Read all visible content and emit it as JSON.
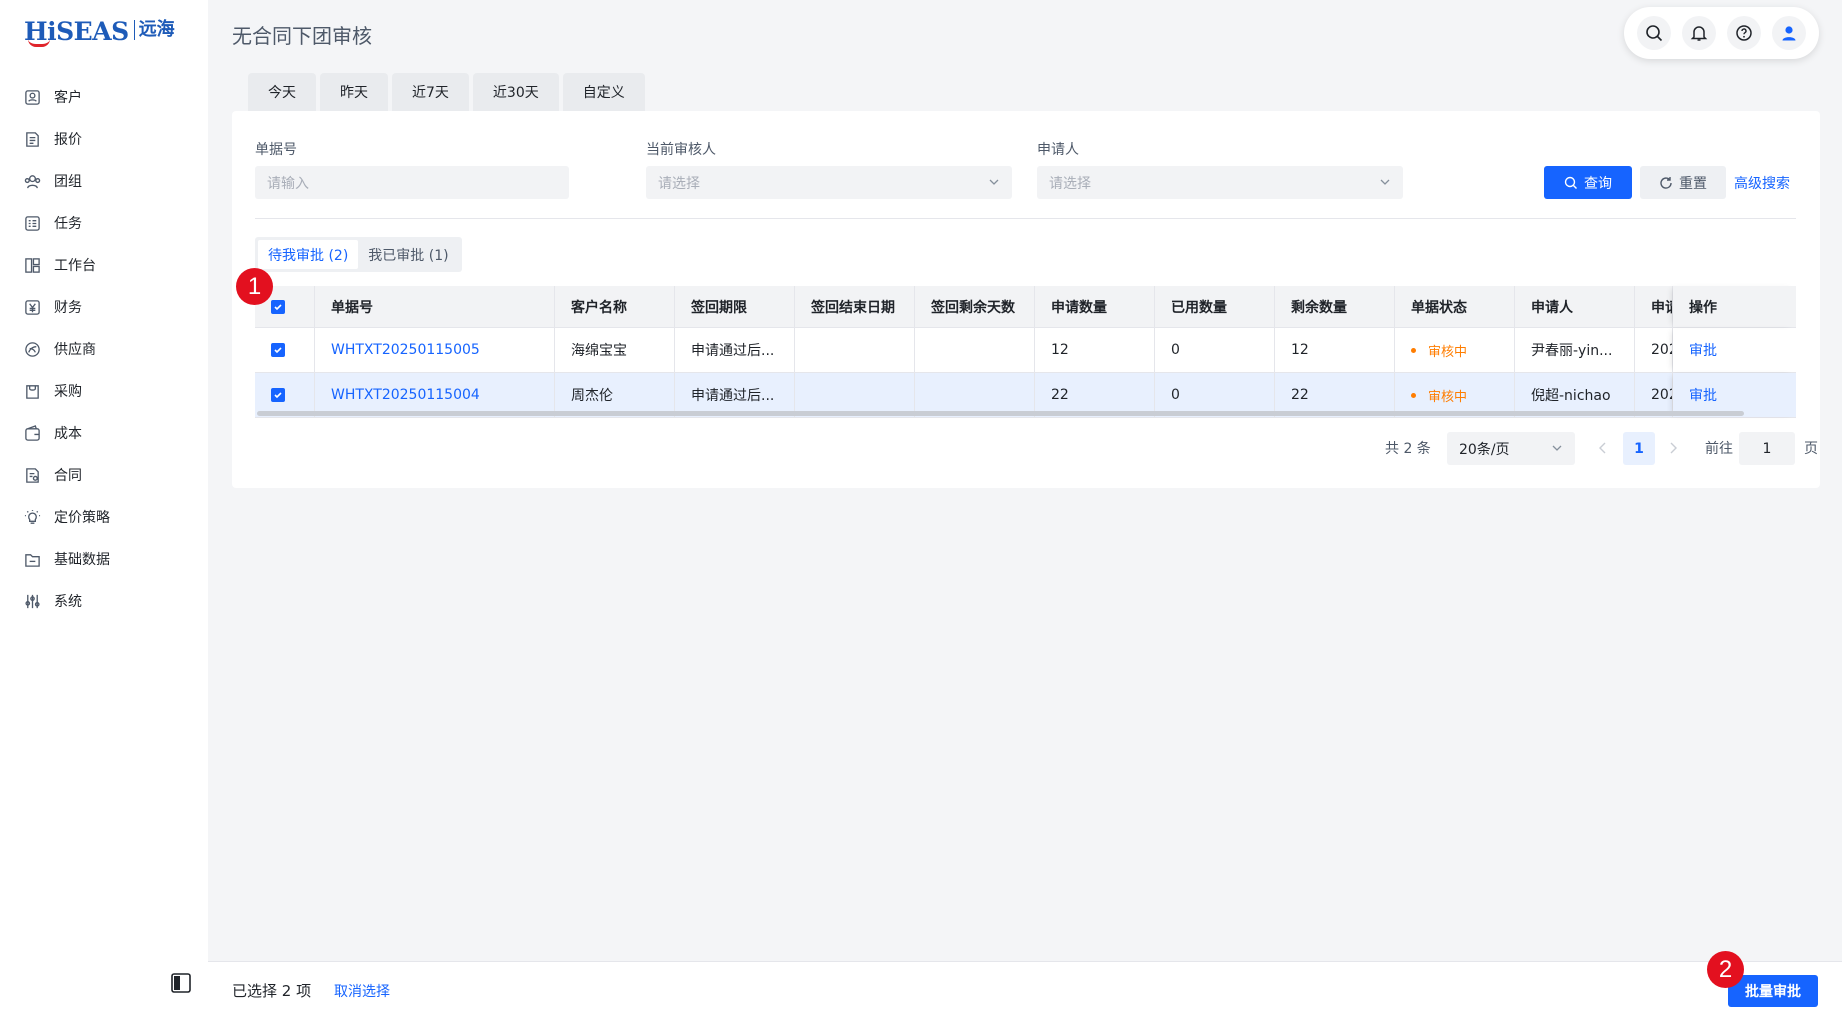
{
  "app": {
    "logo_en": "HiSEAS",
    "logo_cn": "远海",
    "page_title": "无合同下团审核"
  },
  "sidebar": {
    "items": [
      {
        "label": "客户",
        "icon": "customer-icon"
      },
      {
        "label": "报价",
        "icon": "quote-icon"
      },
      {
        "label": "团组",
        "icon": "group-icon"
      },
      {
        "label": "任务",
        "icon": "task-icon"
      },
      {
        "label": "工作台",
        "icon": "workbench-icon"
      },
      {
        "label": "财务",
        "icon": "finance-icon"
      },
      {
        "label": "供应商",
        "icon": "supplier-icon"
      },
      {
        "label": "采购",
        "icon": "purchase-icon"
      },
      {
        "label": "成本",
        "icon": "cost-icon"
      },
      {
        "label": "合同",
        "icon": "contract-icon"
      },
      {
        "label": "定价策略",
        "icon": "pricing-icon"
      },
      {
        "label": "基础数据",
        "icon": "folder-icon"
      },
      {
        "label": "系统",
        "icon": "settings-sliders-icon"
      }
    ]
  },
  "header": {
    "icons": [
      "search-icon",
      "bell-icon",
      "help-icon",
      "user-icon"
    ]
  },
  "date_tabs": [
    "今天",
    "昨天",
    "近7天",
    "近30天",
    "自定义"
  ],
  "filters": {
    "doc_no": {
      "label": "单据号",
      "placeholder": "请输入"
    },
    "reviewer": {
      "label": "当前审核人",
      "placeholder": "请选择"
    },
    "applicant": {
      "label": "申请人",
      "placeholder": "请选择"
    },
    "query_label": "查询",
    "reset_label": "重置",
    "advanced_label": "高级搜索"
  },
  "status_tabs": [
    "待我审批 (2)",
    "我已审批 (1)"
  ],
  "table": {
    "columns": [
      "单据号",
      "客户名称",
      "签回期限",
      "签回结束日期",
      "签回剩余天数",
      "申请数量",
      "已用数量",
      "剩余数量",
      "单据状态",
      "申请人",
      "申请",
      "操作"
    ],
    "rows": [
      {
        "doc_no": "WHTXT20250115005",
        "customer": "海绵宝宝",
        "period": "申请通过后...",
        "end_date": "",
        "remaining_days": "",
        "qty": "12",
        "used": "0",
        "left": "12",
        "status": "审核中",
        "applicant": "尹春丽-yin...",
        "more": "202",
        "action": "审批"
      },
      {
        "doc_no": "WHTXT20250115004",
        "customer": "周杰伦",
        "period": "申请通过后...",
        "end_date": "",
        "remaining_days": "",
        "qty": "22",
        "used": "0",
        "left": "22",
        "status": "审核中",
        "applicant": "倪超-nichao",
        "more": "202",
        "action": "审批"
      }
    ]
  },
  "pagination": {
    "total": "共 2 条",
    "page_size": "20条/页",
    "current": "1",
    "goto_label": "前往",
    "goto_value": "1",
    "unit": "页"
  },
  "footer": {
    "selected": "已选择 2 项",
    "cancel": "取消选择",
    "batch": "批量审批"
  },
  "markers": [
    "1",
    "2"
  ],
  "colors": {
    "primary": "#1664ff",
    "status": "#ff7d00",
    "marker": "#e3101f"
  }
}
